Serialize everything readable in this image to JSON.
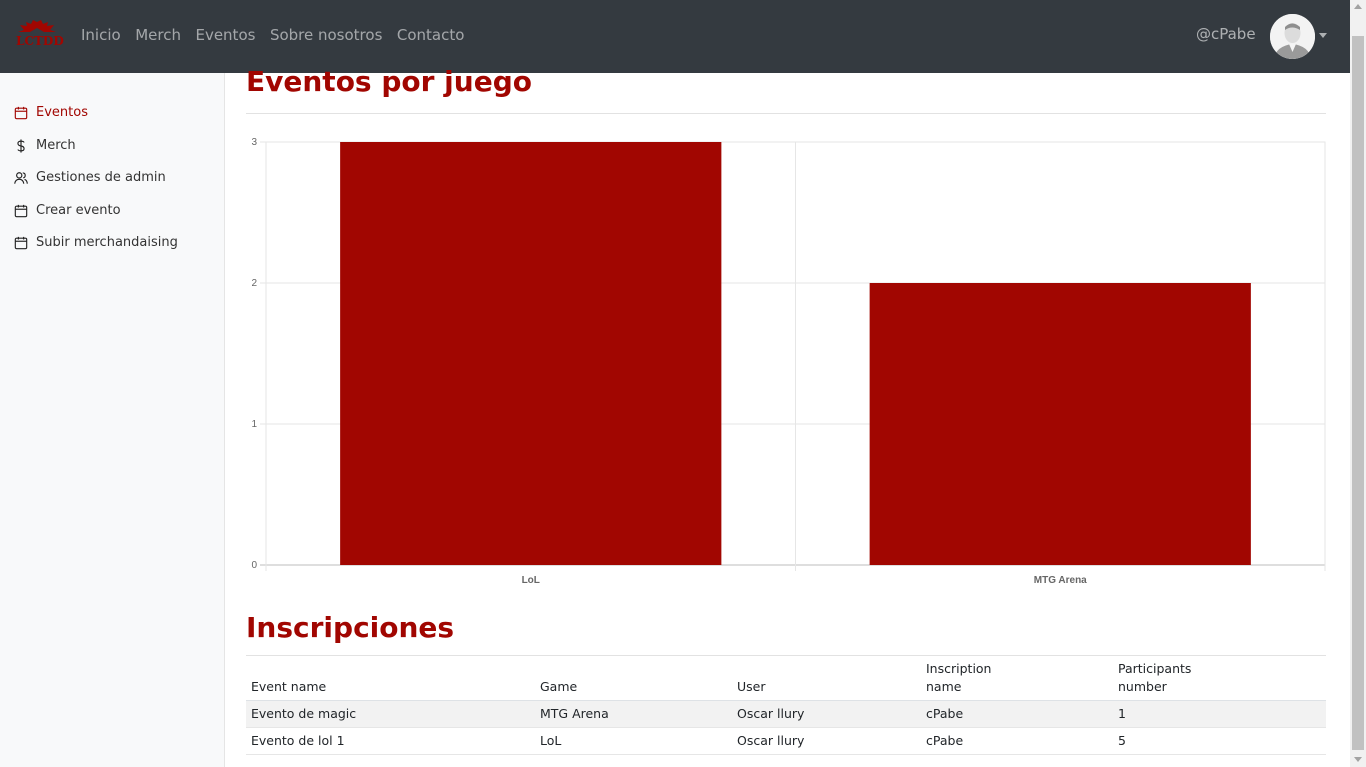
{
  "brand": {
    "logo_text": "LCTDD",
    "accent_color": "#a10601"
  },
  "nav": {
    "links": [
      "Inicio",
      "Merch",
      "Eventos",
      "Sobre nosotros",
      "Contacto"
    ],
    "user_handle": "@cPabe",
    "avatar_icon": "user-avatar"
  },
  "sidebar": {
    "items": [
      {
        "label": "Eventos",
        "icon": "calendar-icon",
        "active": true
      },
      {
        "label": "Merch",
        "icon": "dollar-icon",
        "active": false
      },
      {
        "label": "Gestiones de admin",
        "icon": "users-icon",
        "active": false
      },
      {
        "label": "Crear evento",
        "icon": "calendar-icon",
        "active": false
      },
      {
        "label": "Subir merchandaising",
        "icon": "calendar-icon",
        "active": false
      }
    ]
  },
  "main": {
    "events_title": "Eventos por juego",
    "inscriptions_title": "Inscripciones"
  },
  "chart_data": {
    "type": "bar",
    "categories": [
      "LoL",
      "MTG Arena"
    ],
    "values": [
      3,
      2
    ],
    "ylim": [
      0,
      3
    ],
    "yticks": [
      0,
      1,
      2,
      3
    ],
    "grid": true,
    "bar_color": "#a10601"
  },
  "table": {
    "headers": [
      "Event name",
      "Game",
      "User",
      "Inscription name",
      "Participants number"
    ],
    "rows": [
      [
        "Evento de magic",
        "MTG Arena",
        "Oscar llury",
        "cPabe",
        "1"
      ],
      [
        "Evento de lol 1",
        "LoL",
        "Oscar llury",
        "cPabe",
        "5"
      ]
    ]
  }
}
